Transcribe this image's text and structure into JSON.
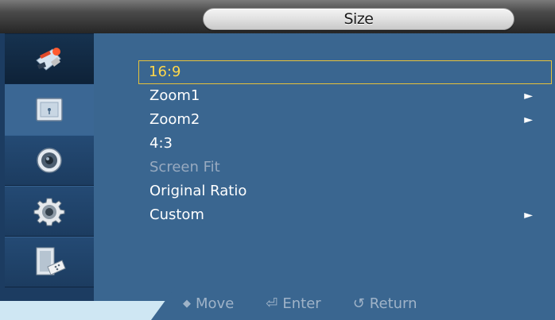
{
  "header": {
    "title": "Size"
  },
  "sidebar": {
    "items": [
      {
        "icon": "picture-icon",
        "state": "active"
      },
      {
        "icon": "sound-frame-icon"
      },
      {
        "icon": "speaker-icon"
      },
      {
        "icon": "gear-icon"
      },
      {
        "icon": "monitor-remote-icon"
      }
    ]
  },
  "menu": {
    "items": [
      {
        "label": "16:9",
        "selected": true,
        "submenu": false
      },
      {
        "label": "Zoom1",
        "submenu": true,
        "arrow": "►"
      },
      {
        "label": "Zoom2",
        "submenu": true,
        "arrow": "►"
      },
      {
        "label": "4:3",
        "submenu": false
      },
      {
        "label": "Screen Fit",
        "disabled": true,
        "submenu": false
      },
      {
        "label": "Original Ratio",
        "submenu": false
      },
      {
        "label": "Custom",
        "submenu": true,
        "arrow": "►"
      }
    ]
  },
  "footer": {
    "move_icon": "◆",
    "move_label": "Move",
    "enter_icon": "⏎",
    "enter_label": "Enter",
    "return_icon": "↺",
    "return_label": "Return"
  },
  "colors": {
    "background": "#3a6690",
    "selected_text": "#ffd84a",
    "selected_border": "#e6c13a",
    "disabled_text": "#98aac0",
    "hint_text": "#9fb3c8"
  }
}
